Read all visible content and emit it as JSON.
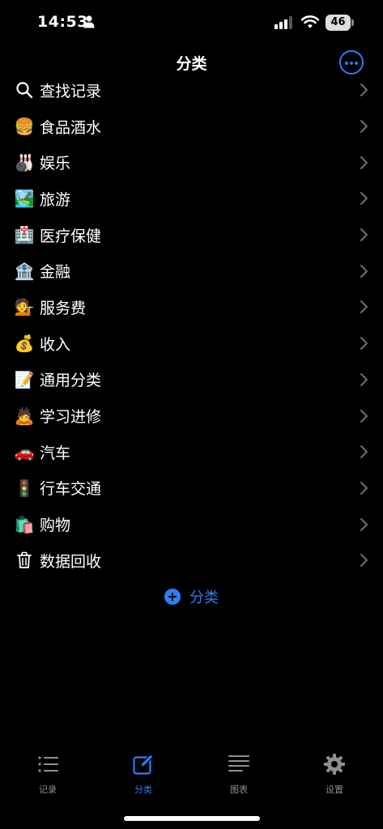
{
  "status_bar": {
    "time": "14:53",
    "battery": "46"
  },
  "nav": {
    "title": "分类"
  },
  "categories": [
    {
      "icon": "search-icon",
      "label": "查找记录"
    },
    {
      "icon": "🍔",
      "label": "食品酒水"
    },
    {
      "icon": "🎳",
      "label": "娱乐"
    },
    {
      "icon": "🏞️",
      "label": "旅游"
    },
    {
      "icon": "🏥",
      "label": "医疗保健"
    },
    {
      "icon": "🏦",
      "label": "金融"
    },
    {
      "icon": "💁",
      "label": "服务费"
    },
    {
      "icon": "💰",
      "label": "收入"
    },
    {
      "icon": "📝",
      "label": "通用分类"
    },
    {
      "icon": "🙇",
      "label": "学习进修"
    },
    {
      "icon": "🚗",
      "label": "汽车"
    },
    {
      "icon": "🚦",
      "label": "行车交通"
    },
    {
      "icon": "🛍️",
      "label": "购物"
    },
    {
      "icon": "trash-icon",
      "label": "数据回收"
    }
  ],
  "add_category": {
    "label": "分类"
  },
  "tabs": [
    {
      "label": "记录",
      "icon": "list-icon",
      "active": false
    },
    {
      "label": "分类",
      "icon": "edit-icon",
      "active": true
    },
    {
      "label": "图表",
      "icon": "text-lines-icon",
      "active": false
    },
    {
      "label": "设置",
      "icon": "gear-icon",
      "active": false
    }
  ],
  "colors": {
    "accent": "#2f7cf6",
    "background": "#000000",
    "inactive_tab": "#8e8e93"
  }
}
